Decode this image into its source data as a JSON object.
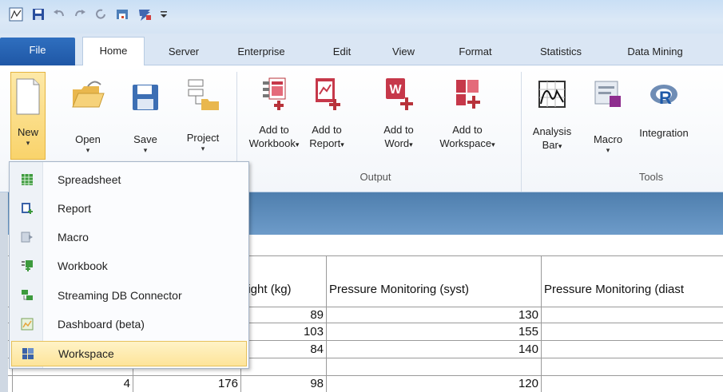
{
  "quick_access": [
    "app-icon",
    "save-icon",
    "undo-icon",
    "redo-icon",
    "refresh-icon",
    "print-icon",
    "statistica-icon",
    "customize-icon"
  ],
  "tabs": [
    {
      "label": "File"
    },
    {
      "label": "Home"
    },
    {
      "label": "Server"
    },
    {
      "label": "Enterprise"
    },
    {
      "label": "Edit"
    },
    {
      "label": "View"
    },
    {
      "label": "Format"
    },
    {
      "label": "Statistics"
    },
    {
      "label": "Data Mining"
    }
  ],
  "ribbon": {
    "new_label": "New",
    "open_label": "Open",
    "save_label": "Save",
    "project_label": "Project",
    "add_to_workbook": [
      "Add to",
      "Workbook"
    ],
    "add_to_report": [
      "Add to",
      "Report"
    ],
    "add_to_word": [
      "Add to",
      "Word"
    ],
    "add_to_workspace": [
      "Add to",
      "Workspace"
    ],
    "output_group": "Output",
    "analysis_bar": [
      "Analysis",
      "Bar"
    ],
    "macro_label": "Macro",
    "integration_label": "Integration",
    "tools_group": "Tools",
    "dropdown_arrow": "▾"
  },
  "menu": {
    "items": [
      {
        "label": "Spreadsheet",
        "icon": "spreadsheet-icon"
      },
      {
        "label": "Report",
        "icon": "report-icon"
      },
      {
        "label": "Macro",
        "icon": "macro-icon"
      },
      {
        "label": "Workbook",
        "icon": "workbook-icon"
      },
      {
        "label": "Streaming DB Connector",
        "icon": "db-connector-icon"
      },
      {
        "label": "Dashboard (beta)",
        "icon": "dashboard-icon"
      },
      {
        "label": "Workspace",
        "icon": "workspace-icon"
      }
    ],
    "selected": "Workspace"
  },
  "grid": {
    "headers": [
      "eight (kg)",
      "Pressure Monitoring (syst)",
      "Pressure Monitoring (diast"
    ],
    "rows": [
      {
        "row": "",
        "height": "",
        "weight": "89",
        "syst": "130"
      },
      {
        "row": "",
        "height": "",
        "weight": "103",
        "syst": "155"
      },
      {
        "row": "",
        "height": "",
        "weight": "84",
        "syst": "140"
      },
      {
        "row": "4",
        "height": "176",
        "weight": "98",
        "syst": "120"
      }
    ]
  },
  "colors": {
    "file_tab": "#1f57a6",
    "highlight": "#f9d36b",
    "band": "#5d8cbc"
  }
}
